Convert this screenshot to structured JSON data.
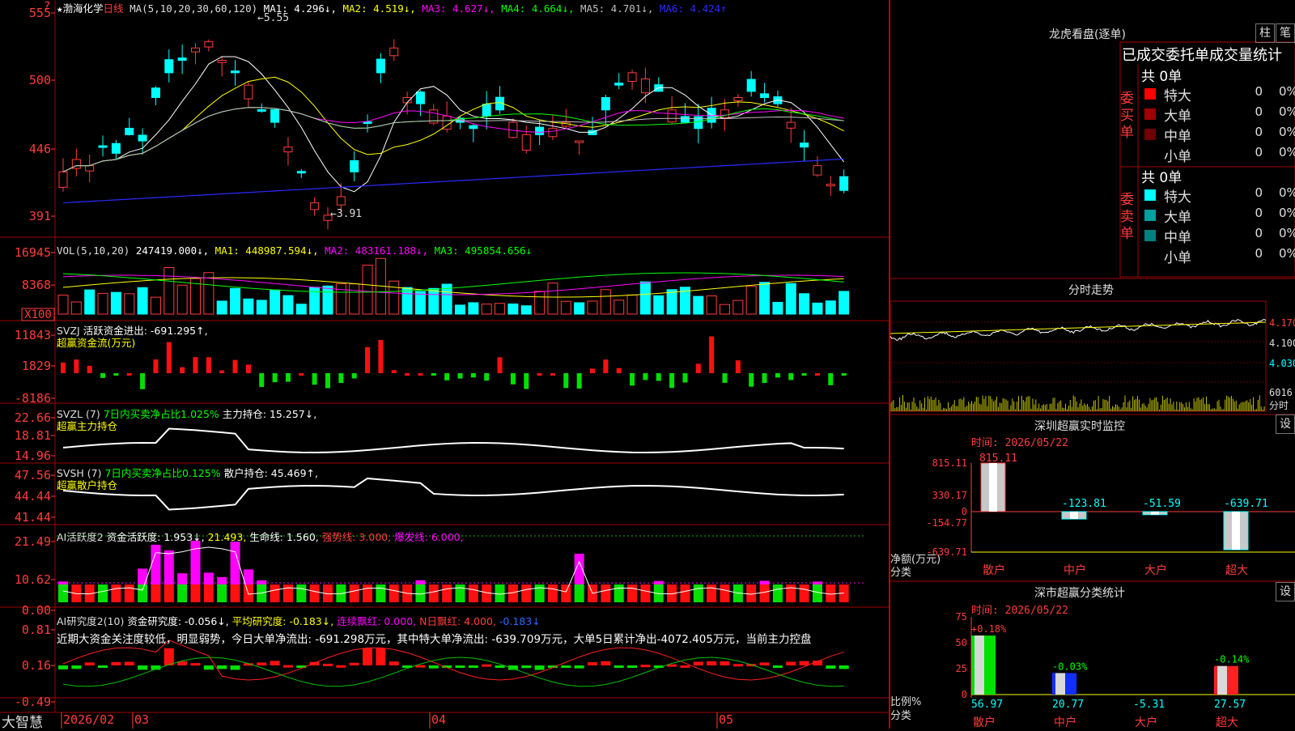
{
  "main": {
    "star": "★",
    "stock_name": "渤海化学",
    "period": "日线",
    "ma_params": "MA(5,10,20,30,60,120)",
    "ma_values": [
      {
        "label": "MA1: 4.296↓",
        "color": "#ffffff"
      },
      {
        "label": "MA2: 4.519↓",
        "color": "#ffff00"
      },
      {
        "label": "MA3: 4.627↓",
        "color": "#ff00ff"
      },
      {
        "label": "MA4: 4.664↓",
        "color": "#00ff00"
      },
      {
        "label": "MA5: 4.701↓",
        "color": "#c0c0c0"
      },
      {
        "label": "MA6: 4.424↑",
        "color": "#2a2aff"
      }
    ],
    "y_labels": [
      "555",
      "500",
      "446",
      "391"
    ],
    "high_label": "5.55",
    "low_label": "3.91",
    "corner_mark": "?"
  },
  "vol": {
    "header": "VOL(5,10,20)",
    "value": "247419.000↓,",
    "mas": [
      {
        "label": "MA1: 448987.594↓,",
        "color": "#ffff00"
      },
      {
        "label": "MA2: 483161.188↓,",
        "color": "#ff00ff"
      },
      {
        "label": "MA3: 495854.656↓",
        "color": "#00ff00"
      }
    ],
    "y_labels": [
      "16945",
      "8368"
    ],
    "unit": "X100"
  },
  "svzj": {
    "header": "SVZJ",
    "line1": "活跃资金进出: -691.295↑,",
    "line2": "超赢资金流(万元)",
    "y_labels": [
      "11843",
      "1829",
      "-8186"
    ]
  },
  "svzl": {
    "header": "SVZL (7)",
    "green_text": "7日内买卖净占比1.025%",
    "white_text": "主力持仓: 15.257↓,",
    "line2": "超赢主力持仓",
    "y_labels": [
      "22.66",
      "18.81",
      "14.96"
    ]
  },
  "svsh": {
    "header": "SVSH (7)",
    "green_text": "7日内买卖净占比0.125%",
    "white_text": "散户持仓: 45.469↑,",
    "line2": "超赢散户持仓",
    "y_labels": [
      "47.56",
      "44.44",
      "41.44"
    ]
  },
  "ai_active": {
    "header": "AI活跃度2",
    "p1": "资金活跃度: 1.953↓,",
    "p2": "21.493,",
    "p3": "生命线: 1.560,",
    "p4": "强势线: 3.000,",
    "p5": "爆发线: 6.000,",
    "y_labels": [
      "21.49",
      "10.62",
      "0.00"
    ]
  },
  "ai_research": {
    "header": "AI研究度2(10)",
    "p1": "资金研究度: -0.056↓,",
    "p2": "平均研究度: -0.183↓,",
    "p3": "连续飘红: 0.000,",
    "p4": "N日飘红: 4.000,",
    "p5": "-0.183↓",
    "comment": "近期大资金关注度较低，明显弱势，今日大单净流出: -691.298万元，其中特大单净流出: -639.709万元，大单5日累计净出-4072.405万元，当前主力控盘",
    "y_labels": [
      "0.81",
      "0.16",
      "-0.49"
    ]
  },
  "bottom": {
    "brand": "大智慧",
    "months": [
      "2026/02",
      "03",
      "04",
      "05"
    ]
  },
  "right": {
    "title": "龙虎看盘(逐单)",
    "btn_a": "柱",
    "btn_b": "笔",
    "tabs_title": "已成交委托单成交量统计",
    "buy_label": "委买单",
    "sell_label": "委卖单",
    "buy_total": "共 0单",
    "sell_total": "共 0单",
    "buy_rows": [
      {
        "name": "特大",
        "n": "0",
        "pct": "0%",
        "color": "#ff0000"
      },
      {
        "name": "大单",
        "n": "0",
        "pct": "0%",
        "color": "#a00000"
      },
      {
        "name": "中单",
        "n": "0",
        "pct": "0%",
        "color": "#700000"
      },
      {
        "name": "小单",
        "n": "0",
        "pct": "0%",
        "color": ""
      }
    ],
    "sell_rows": [
      {
        "name": "特大",
        "n": "0",
        "pct": "0%",
        "color": "#00ffff"
      },
      {
        "name": "大单",
        "n": "0",
        "pct": "0%",
        "color": "#00a0a0"
      },
      {
        "name": "中单",
        "n": "0",
        "pct": "0%",
        "color": "#008080"
      },
      {
        "name": "小单",
        "n": "0",
        "pct": "0%",
        "color": ""
      }
    ],
    "minute": {
      "title": "分时走势",
      "prices": [
        "4.170",
        "4.100",
        "4.030"
      ],
      "vol": "6016",
      "vol_unit": "分时"
    },
    "sz_monitor": {
      "title": "深圳超赢实时监控",
      "btn": "设",
      "time": "时间: 2026/05/22",
      "y_labels": [
        "815.11",
        "330.17",
        "0",
        "-154.77",
        "-639.71"
      ],
      "unit1": "净额(万元)",
      "unit2": "分类",
      "bars": [
        {
          "cat": "散户",
          "value": 815.11,
          "label": "815.11",
          "color": "#ff3c3c"
        },
        {
          "cat": "中户",
          "value": -123.81,
          "label": "-123.81",
          "color": "#00ffff"
        },
        {
          "cat": "大户",
          "value": -51.59,
          "label": "-51.59",
          "color": "#00ffff"
        },
        {
          "cat": "超大",
          "value": -639.71,
          "label": "-639.71",
          "color": "#00ffff"
        }
      ]
    },
    "sz_class": {
      "title": "深市超赢分类统计",
      "btn": "设",
      "time": "时间: 2026/05/22",
      "y_labels": [
        "75",
        "50",
        "25",
        "0"
      ],
      "unit1": "比例%",
      "unit2": "分类",
      "bars": [
        {
          "cat": "散户",
          "value": 56.97,
          "label": "56.97",
          "top": "+0.18%",
          "top_color": "#ff3c3c",
          "fill": "#00e000"
        },
        {
          "cat": "中户",
          "value": 20.77,
          "label": "20.77",
          "top": "-0.03%",
          "top_color": "#00ff00",
          "fill": "#1030ff"
        },
        {
          "cat": "大户",
          "value": -5.31,
          "label": "-5.31",
          "top": "",
          "top_color": "#00ff00",
          "fill": "#00ffff"
        },
        {
          "cat": "超大",
          "value": 27.57,
          "label": "27.57",
          "top": "-0.14%",
          "top_color": "#00ff00",
          "fill": "#ff2020"
        }
      ]
    }
  }
}
